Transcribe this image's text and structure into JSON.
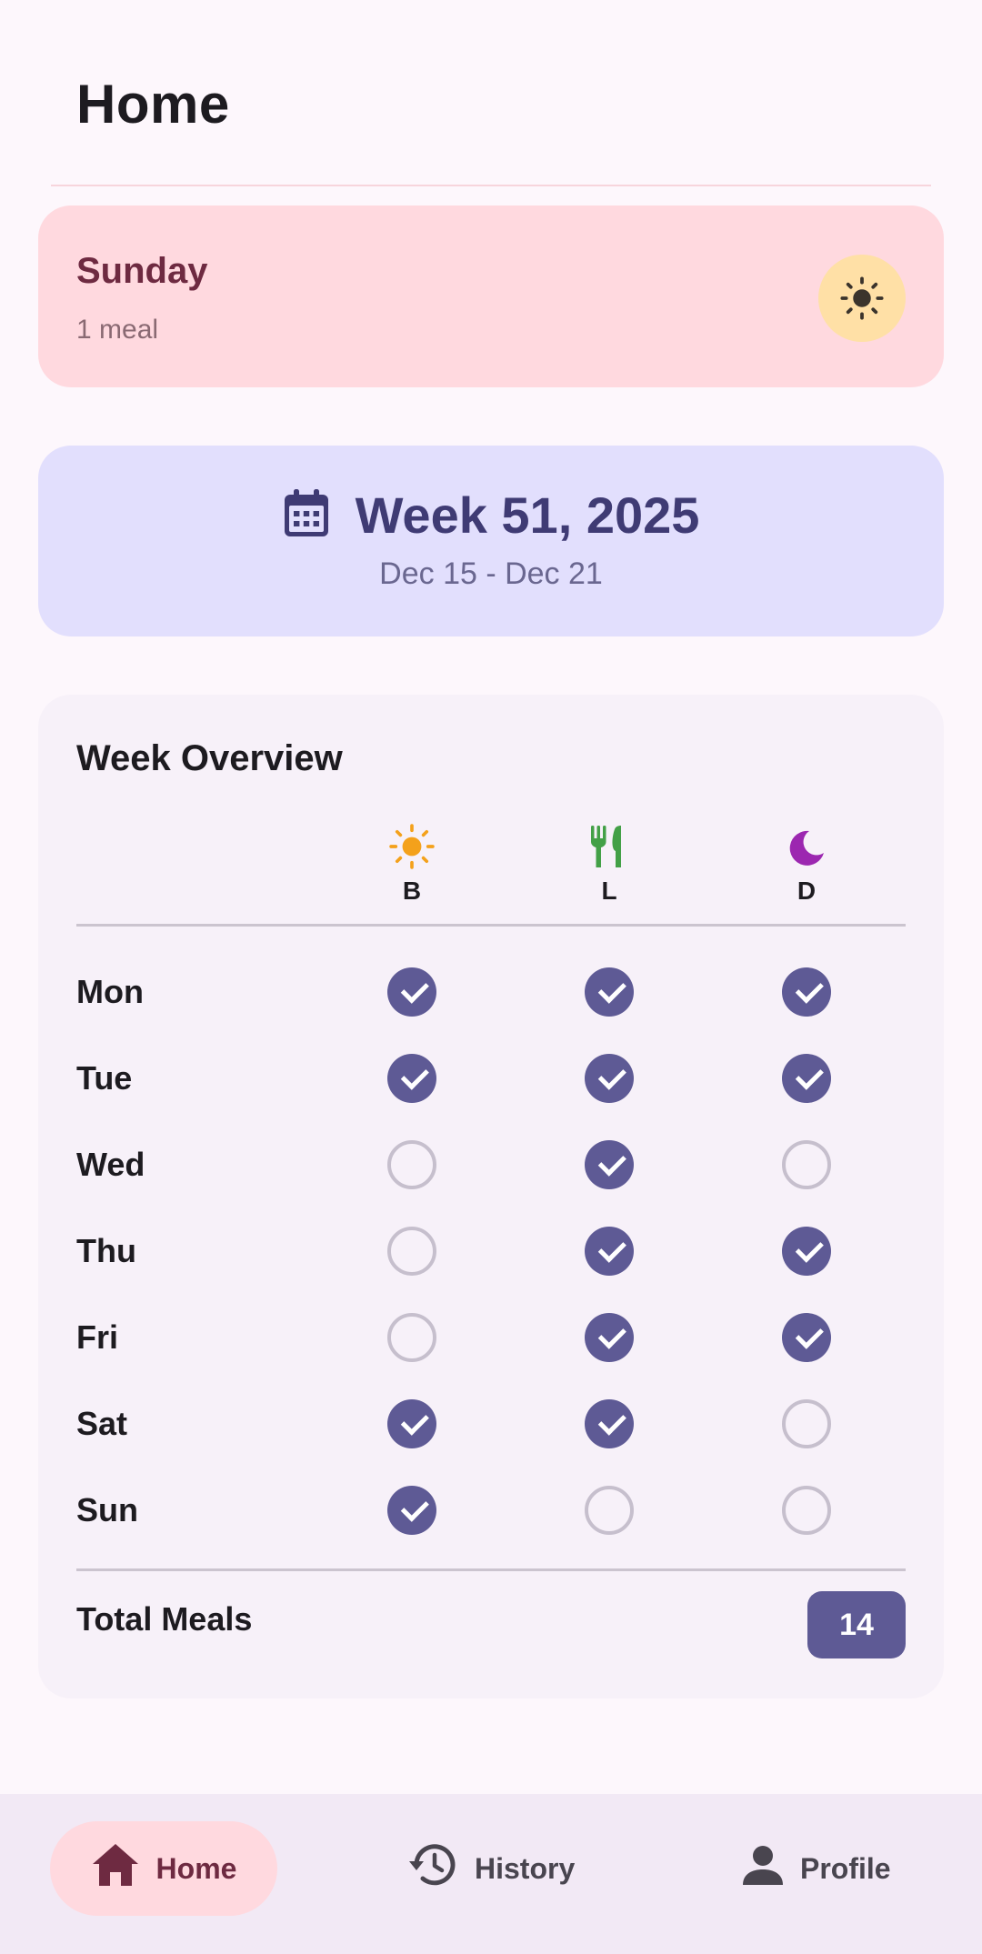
{
  "header": {
    "title": "Home"
  },
  "today": {
    "day": "Sunday",
    "meals": "1 meal",
    "icon": "sun-icon"
  },
  "week": {
    "title": "Week 51, 2025",
    "range": "Dec 15 - Dec 21",
    "icon": "calendar-icon"
  },
  "overview": {
    "title": "Week Overview",
    "meals": [
      {
        "label": "B",
        "icon": "breakfast-sun-icon",
        "color": "#f4a11b"
      },
      {
        "label": "L",
        "icon": "lunch-utensils-icon",
        "color": "#43a047"
      },
      {
        "label": "D",
        "icon": "dinner-moon-icon",
        "color": "#9c27b0"
      }
    ],
    "days": [
      {
        "name": "Mon",
        "b": true,
        "l": true,
        "d": true
      },
      {
        "name": "Tue",
        "b": true,
        "l": true,
        "d": true
      },
      {
        "name": "Wed",
        "b": false,
        "l": true,
        "d": false
      },
      {
        "name": "Thu",
        "b": false,
        "l": true,
        "d": true
      },
      {
        "name": "Fri",
        "b": false,
        "l": true,
        "d": true
      },
      {
        "name": "Sat",
        "b": true,
        "l": true,
        "d": false
      },
      {
        "name": "Sun",
        "b": true,
        "l": false,
        "d": false
      }
    ],
    "total_label": "Total Meals",
    "total_value": "14"
  },
  "nav": {
    "items": [
      {
        "label": "Home",
        "icon": "home-icon",
        "active": true
      },
      {
        "label": "History",
        "icon": "history-icon",
        "active": false
      },
      {
        "label": "Profile",
        "icon": "person-icon",
        "active": false
      }
    ]
  },
  "colors": {
    "background": "#fdf7fc",
    "today_card": "#ffd9df",
    "week_card": "#e2dffd",
    "overview_card": "#f7f1f9",
    "accent": "#5e5a95",
    "nav_bar": "#f2e9f5"
  }
}
